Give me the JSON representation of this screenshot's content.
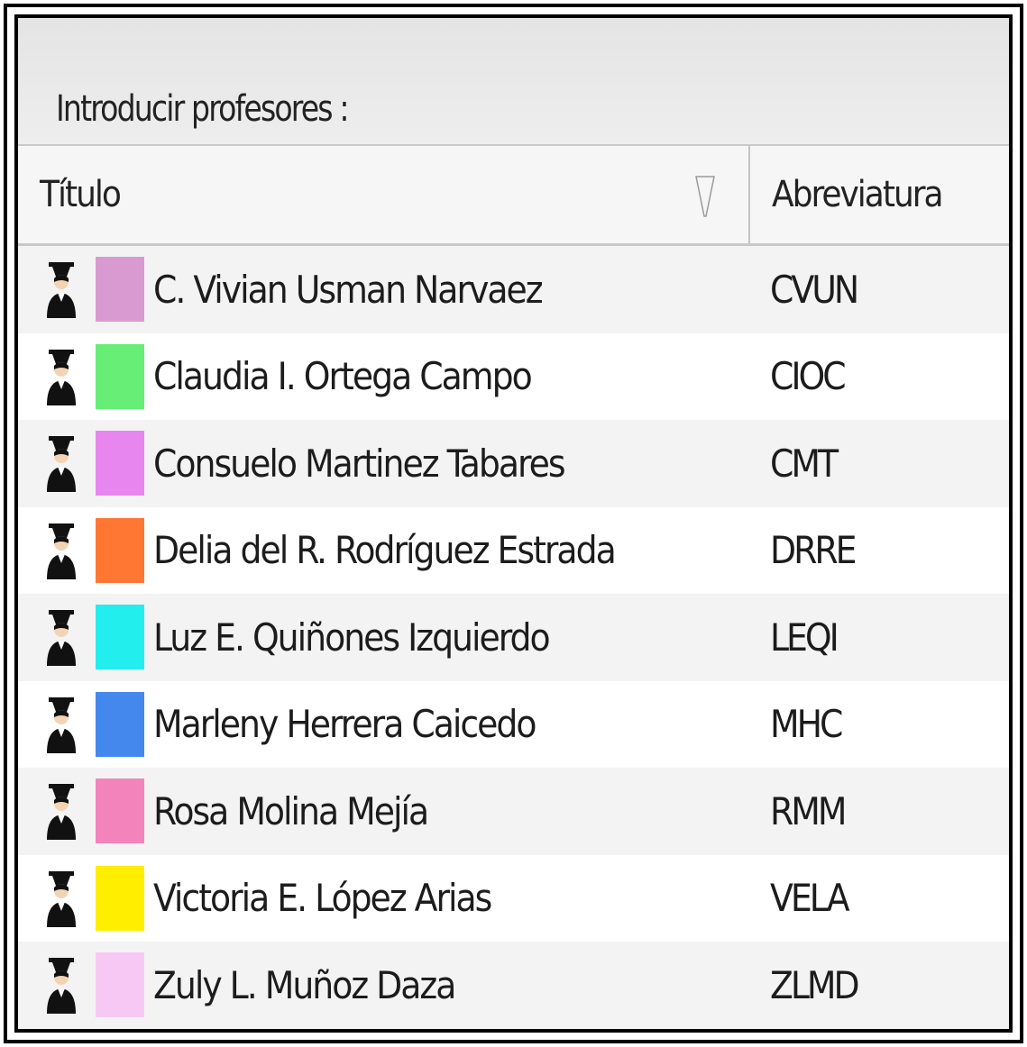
{
  "panel": {
    "prompt_label": "Introducir profesores :"
  },
  "table": {
    "columns": [
      {
        "label": "Título",
        "sort_icon": "sort-indicator-icon"
      },
      {
        "label": "Abreviatura"
      }
    ],
    "rows": [
      {
        "name": "C. Vivian Usman Narvaez",
        "abbr": "CVUN",
        "color": "#d99ad2",
        "icon": "teacher-icon"
      },
      {
        "name": "Claudia I. Ortega Campo",
        "abbr": "CIOC",
        "color": "#66ee77",
        "icon": "teacher-icon"
      },
      {
        "name": "Consuelo Martinez Tabares",
        "abbr": "CMT",
        "color": "#e686ee",
        "icon": "teacher-icon"
      },
      {
        "name": "Delia del R. Rodríguez Estrada",
        "abbr": "DRRE",
        "color": "#ff7733",
        "icon": "teacher-icon"
      },
      {
        "name": "Luz E. Quiñones Izquierdo",
        "abbr": "LEQI",
        "color": "#22eeee",
        "icon": "teacher-icon"
      },
      {
        "name": "Marleny Herrera Caicedo",
        "abbr": "MHC",
        "color": "#4488ee",
        "icon": "teacher-icon"
      },
      {
        "name": "Rosa Molina Mejía",
        "abbr": "RMM",
        "color": "#f383bb",
        "icon": "teacher-icon"
      },
      {
        "name": "Victoria E. López Arias",
        "abbr": "VELA",
        "color": "#ffee00",
        "icon": "teacher-icon"
      },
      {
        "name": "Zuly L. Muñoz Daza",
        "abbr": "ZLMD",
        "color": "#f8c8f4",
        "icon": "teacher-icon"
      }
    ]
  }
}
